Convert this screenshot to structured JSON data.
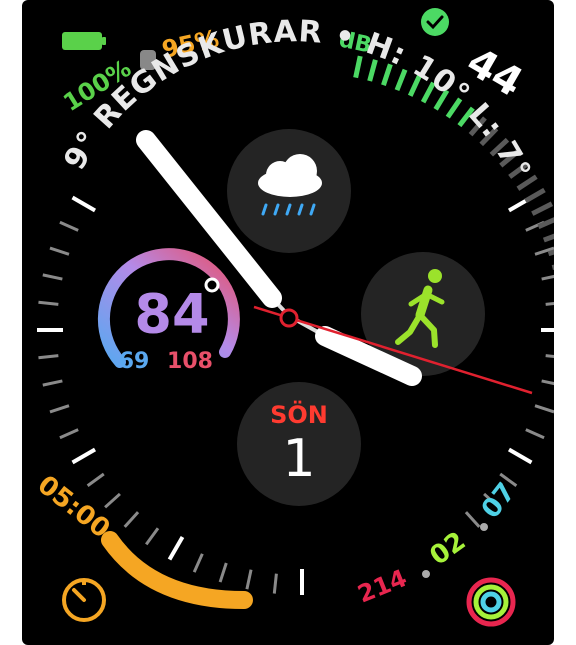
{
  "watch_face": {
    "battery": {
      "percent": "100%",
      "color": "#5ad14a"
    },
    "watch_battery": {
      "percent": "95%",
      "color": "#f5a623"
    },
    "noise": {
      "unit": "dB",
      "value": "44",
      "color": "#4cd964"
    },
    "weather_text": {
      "temp": "9°",
      "condition": "REGNSKURAR",
      "high": "H: 10°",
      "low": "L: 7°"
    },
    "heart_rate": {
      "current": "84",
      "low": "69",
      "high": "108"
    },
    "calendar": {
      "weekday": "SÖN",
      "day": "1"
    },
    "timer": {
      "label": "05:00"
    },
    "activity": {
      "move": "214",
      "exercise": "02",
      "stand": "07"
    },
    "complications": {
      "weather_icon": "rain-cloud-icon",
      "workout_icon": "running-figure-icon",
      "timer_icon": "timer-icon",
      "activity_icon": "activity-rings-icon"
    },
    "colors": {
      "move": "#e8264f",
      "exercise": "#a6f23a",
      "stand": "#4fd1e6",
      "timer": "#f5a623",
      "second_hand": "#e0212f"
    }
  }
}
